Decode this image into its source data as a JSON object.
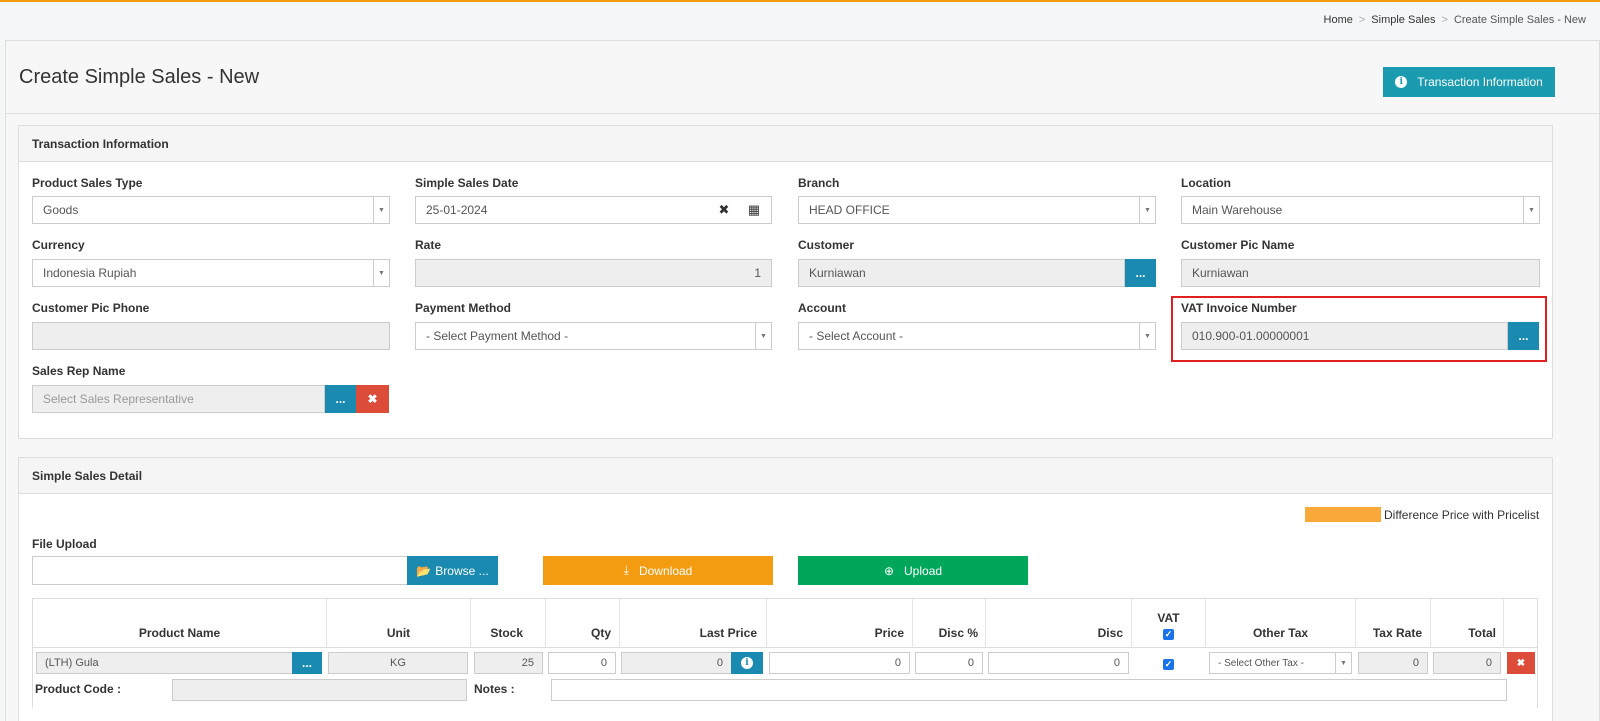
{
  "breadcrumb": [
    "Home",
    "Simple Sales",
    "Create Simple Sales - New"
  ],
  "page_title": "Create Simple Sales - New",
  "header_button": "Transaction Information",
  "transaction": {
    "title": "Transaction Information",
    "product_sales_type": {
      "label": "Product Sales Type",
      "value": "Goods"
    },
    "simple_sales_date": {
      "label": "Simple Sales Date",
      "value": "25-01-2024"
    },
    "branch": {
      "label": "Branch",
      "value": "HEAD OFFICE"
    },
    "location": {
      "label": "Location",
      "value": "Main Warehouse"
    },
    "currency": {
      "label": "Currency",
      "value": "Indonesia Rupiah"
    },
    "rate": {
      "label": "Rate",
      "value": "1"
    },
    "customer": {
      "label": "Customer",
      "value": "Kurniawan",
      "button": "..."
    },
    "customer_pic_name": {
      "label": "Customer Pic Name",
      "value": "Kurniawan"
    },
    "customer_pic_phone": {
      "label": "Customer Pic Phone",
      "value": ""
    },
    "payment_method": {
      "label": "Payment Method",
      "value": "- Select Payment Method -"
    },
    "account": {
      "label": "Account",
      "value": "- Select Account -"
    },
    "vat_invoice": {
      "label": "VAT Invoice Number",
      "value": "010.900-01.00000001",
      "button": "..."
    },
    "sales_rep": {
      "label": "Sales Rep Name",
      "placeholder": "Select Sales Representative",
      "button": "..."
    }
  },
  "detail": {
    "title": "Simple Sales Detail",
    "legend": "Difference Price with Pricelist",
    "legend_color": "#f9a93a",
    "file_upload_label": "File Upload",
    "browse": "Browse ...",
    "download": "Download",
    "upload": "Upload",
    "columns": {
      "product_name": "Product Name",
      "unit": "Unit",
      "stock": "Stock",
      "qty": "Qty",
      "last_price": "Last Price",
      "price": "Price",
      "disc_pct": "Disc %",
      "disc": "Disc",
      "vat": "VAT",
      "other_tax": "Other Tax",
      "tax_rate": "Tax Rate",
      "total": "Total"
    },
    "row": {
      "product_name": "(LTH) Gula",
      "product_button": "...",
      "unit": "KG",
      "stock": "25",
      "qty": "0",
      "last_price": "0",
      "price": "0",
      "disc_pct": "0",
      "disc": "0",
      "other_tax": "- Select Other Tax -",
      "tax_rate": "0",
      "total": "0",
      "product_code_label": "Product Code :",
      "product_code": "",
      "notes_label": "Notes :",
      "notes": ""
    }
  }
}
